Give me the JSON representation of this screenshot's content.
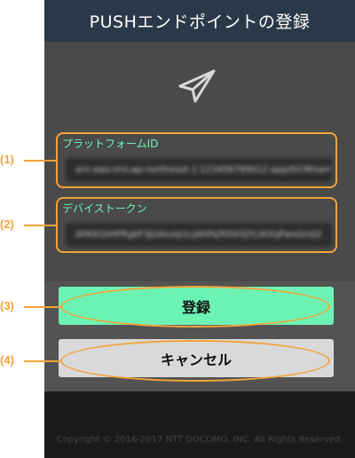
{
  "header": {
    "title": "PUSHエンドポイントの登録"
  },
  "icon": "send-paper-plane-icon",
  "form": {
    "platform_id": {
      "label": "プラットフォームID",
      "value": "arn:aws:sns:ap-northeast-1:123456789012:app/GCM/sample"
    },
    "device_token": {
      "label": "デバイストークン",
      "value": "APA91bHPRgkF3JUikuVp1cjAhPqTrDVVJYLtKXqPwxGnQ2"
    }
  },
  "buttons": {
    "register": "登録",
    "cancel": "キャンセル"
  },
  "footer": {
    "copyright": "Copyright © 2016-2017 NTT DOCOMO, INC. All Rights Reserved."
  },
  "annotations": [
    "(1)",
    "(2)",
    "(3)",
    "(4)"
  ],
  "colors": {
    "title_bar": "#2a3948",
    "accent_green": "#6cf3b4",
    "annotation_orange": "#f2a33a"
  }
}
